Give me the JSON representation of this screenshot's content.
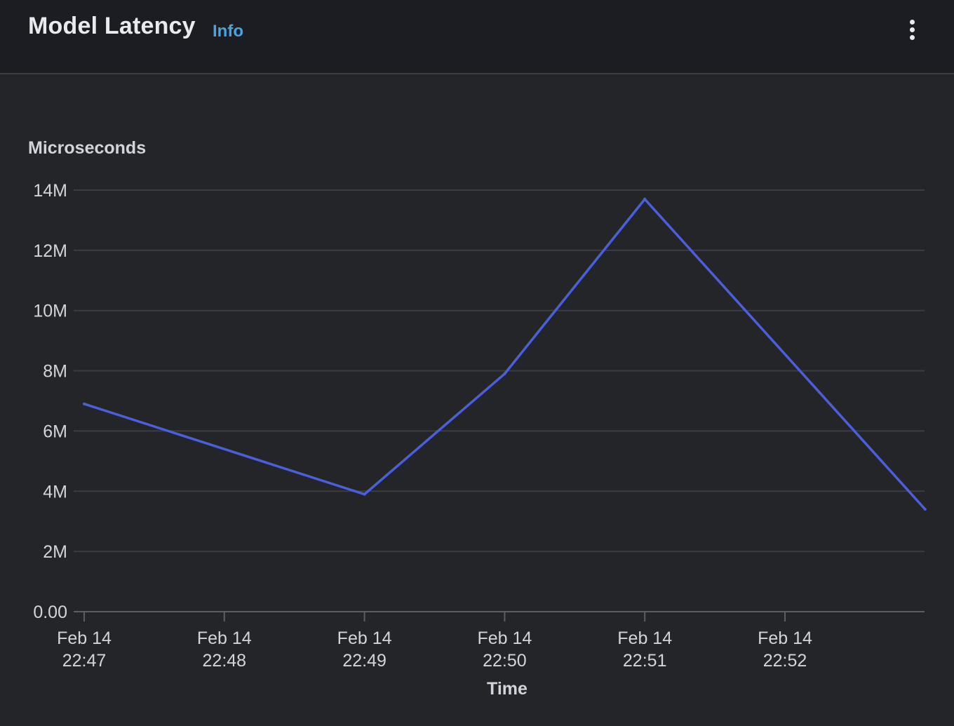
{
  "header": {
    "title": "Model Latency",
    "info_label": "Info",
    "menu_icon": "vertical-ellipsis-icon"
  },
  "colors": {
    "background": "#232529",
    "header_background": "#1b1d22",
    "line": "#4a5fd9",
    "info": "#4aa3df",
    "grid": "#3a3d43"
  },
  "chart_data": {
    "type": "line",
    "ylabel": "Microseconds",
    "xlabel": "Time",
    "yticks": [
      "0.00",
      "2M",
      "4M",
      "6M",
      "8M",
      "10M",
      "12M",
      "14M"
    ],
    "ylim": [
      0,
      14000000
    ],
    "xticks": [
      {
        "date": "Feb 14",
        "time": "22:47"
      },
      {
        "date": "Feb 14",
        "time": "22:48"
      },
      {
        "date": "Feb 14",
        "time": "22:49"
      },
      {
        "date": "Feb 14",
        "time": "22:50"
      },
      {
        "date": "Feb 14",
        "time": "22:51"
      },
      {
        "date": "Feb 14",
        "time": "22:52"
      }
    ],
    "xlim": [
      "22:47",
      "22:53"
    ],
    "grid": true,
    "series": [
      {
        "x": [
          "22:47",
          "22:49",
          "22:50",
          "22:51",
          "22:53"
        ],
        "values": [
          6900000,
          3900000,
          7900000,
          13700000,
          3400000
        ]
      }
    ]
  }
}
